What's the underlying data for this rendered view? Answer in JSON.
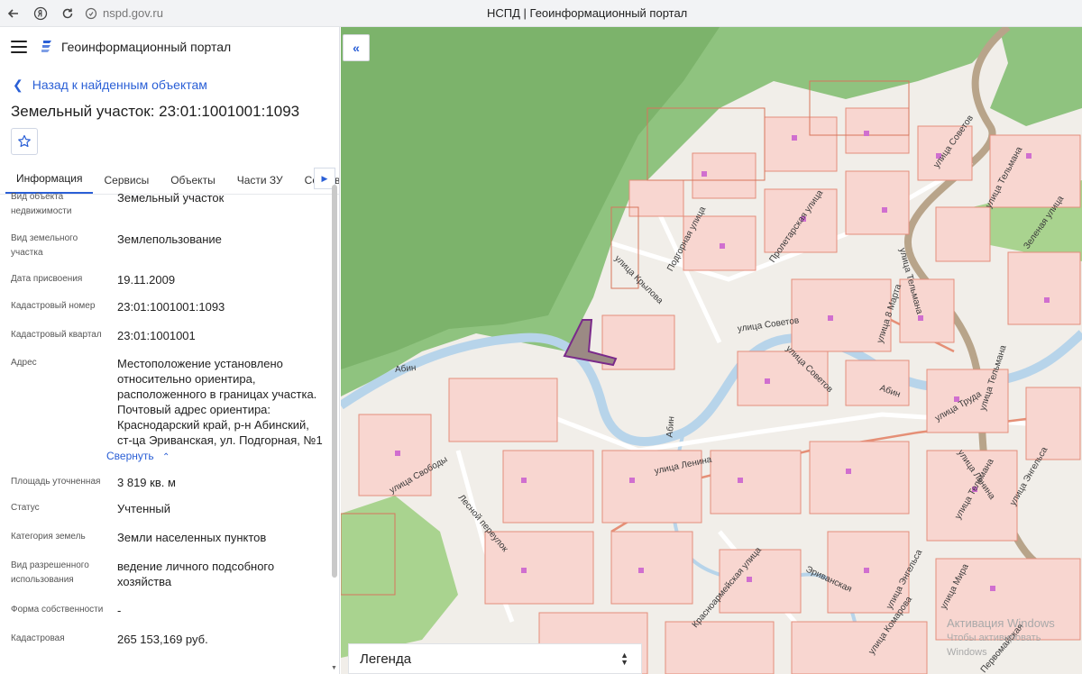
{
  "browser": {
    "url": "nspd.gov.ru",
    "title": "НСПД | Геоинформационный портал"
  },
  "header": {
    "app_title": "Геоинформационный портал"
  },
  "back_link": "Назад к найденным объектам",
  "object_title": "Земельный участок: 23:01:1001001:1093",
  "tabs": [
    {
      "label": "Информация",
      "active": true
    },
    {
      "label": "Сервисы"
    },
    {
      "label": "Объекты"
    },
    {
      "label": "Части ЗУ"
    },
    {
      "label": "Состав"
    }
  ],
  "fields": [
    {
      "label": "Вид объекта недвижимости",
      "value": "Земельный участок"
    },
    {
      "label": "Вид земельного участка",
      "value": "Землепользование"
    },
    {
      "label": "Дата присвоения",
      "value": "19.11.2009"
    },
    {
      "label": "Кадастровый номер",
      "value": "23:01:1001001:1093"
    },
    {
      "label": "Кадастровый квартал",
      "value": "23:01:1001001"
    },
    {
      "label": "Адрес",
      "value": "Местоположение установлено относительно ориентира, расположенного в границах участка. Почтовый адрес ориентира: Краснодарский край, р-н Абинский, ст-ца Эриванская, ул. Подгорная, №1"
    },
    {
      "label": "Площадь уточненная",
      "value": "3 819 кв. м"
    },
    {
      "label": "Статус",
      "value": "Учтенный"
    },
    {
      "label": "Категория земель",
      "value": "Земли населенных пунктов"
    },
    {
      "label": "Вид разрешенного использования",
      "value": "ведение личного подсобного хозяйства"
    },
    {
      "label": "Форма собственности",
      "value": "-"
    },
    {
      "label": "Кадастровая",
      "value": "265 153,169 руб."
    }
  ],
  "collapse_label": "Свернуть",
  "map": {
    "labels": {
      "sovetov_ne": "улица Советов",
      "podgornaya": "Подгорная улица",
      "proletarskaya": "Пролетарская улица",
      "krylova": "улица Крылова",
      "sovetov_c": "улица Советов",
      "sovetov_s": "улица Советов",
      "abin_w": "Абин",
      "abin_c": "Абин",
      "abin_e": "Абин",
      "lenina_c": "улица Ленина",
      "lenina_e": "улица Ленина",
      "svobody": "улица Свободы",
      "lesnoy": "Лесной переулок",
      "krasnoarm": "Красноармейская улица",
      "erivanskaya": "Эриванская",
      "telmana_1": "улица Тельмана",
      "telmana_2": "улица Тельмана",
      "telmana_3": "улица Тельмана",
      "telmana_4": "улица Тельмана",
      "zelenaya": "Зеленая улица",
      "marta": "улица 8 Марта",
      "truda": "улица Труда",
      "engelsa_1": "улица Энгельса",
      "engelsa_2": "улица Энгельса",
      "mira": "улица Мира",
      "komarova": "улица Комарова",
      "pervomayskaya": "Первомайская"
    },
    "legend": "Легенда"
  },
  "watermark": {
    "line1": "Активация Windows",
    "line2": "Чтобы активировать Windows"
  }
}
